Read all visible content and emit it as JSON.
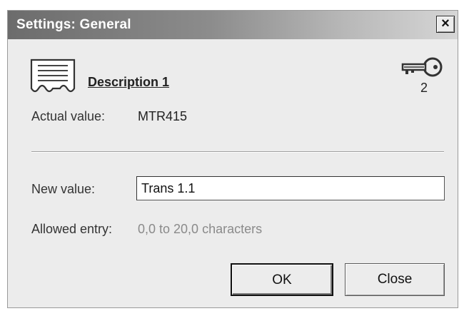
{
  "window": {
    "title": "Settings: General",
    "close_glyph": "×",
    "close_icon": "close-icon"
  },
  "parameter": {
    "icon": "document-icon",
    "name": "Description 1",
    "access_icon": "key-icon",
    "access_level": "2"
  },
  "actual": {
    "label": "Actual value:",
    "value": "MTR415"
  },
  "new_value": {
    "label": "New value:",
    "value": "Trans 1.1"
  },
  "allowed": {
    "label": "Allowed entry:",
    "value": "0,0 to 20,0 characters"
  },
  "buttons": {
    "ok": "OK",
    "close": "Close"
  }
}
